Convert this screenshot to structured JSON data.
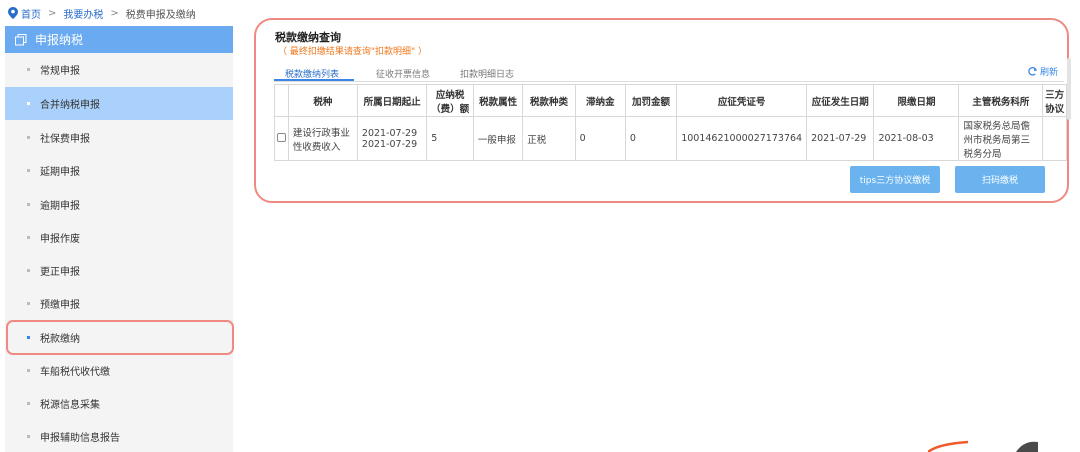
{
  "breadcrumb": {
    "home": "首页",
    "sep1": ">",
    "tax": "我要办税",
    "sep2": ">",
    "current": "税费申报及缴纳"
  },
  "sidebar": {
    "header": "申报纳税",
    "items": [
      {
        "label": "常规申报"
      },
      {
        "label": "合并纳税申报"
      },
      {
        "label": "社保费申报"
      },
      {
        "label": "延期申报"
      },
      {
        "label": "逾期申报"
      },
      {
        "label": "申报作废"
      },
      {
        "label": "更正申报"
      },
      {
        "label": "预缴申报"
      },
      {
        "label": "税款缴纳"
      },
      {
        "label": "车船税代收代缴"
      },
      {
        "label": "税源信息采集"
      },
      {
        "label": "申报辅助信息报告"
      }
    ]
  },
  "main": {
    "title": "税款缴纳查询",
    "notice": "（ 最终扣缴结果请查询\"扣款明细\" ）",
    "tabs": [
      {
        "label": "税款缴纳列表"
      },
      {
        "label": "征收开票信息"
      },
      {
        "label": "扣款明细日志"
      }
    ],
    "refresh": "刷新",
    "table": {
      "headers": [
        "税种",
        "所属日期起止",
        "应纳税（费）额",
        "税款属性",
        "税款种类",
        "滞纳金",
        "加罚金额",
        "应征凭证号",
        "应征发生日期",
        "限缴日期",
        "主管税务科所",
        "三方协议"
      ],
      "row": {
        "tax_type": "建设行政事业性收费收入",
        "date_start": "2021-07-29",
        "date_end": "2021-07-29",
        "amount": "5",
        "attribute": "一般申报",
        "category": "正税",
        "late_fee": "0",
        "penalty": "0",
        "voucher": "10014621000027173764",
        "occur_date": "2021-07-29",
        "deadline": "2021-08-03",
        "office": "国家税务总局儋州市税务局第三税务分局",
        "agreement": ""
      }
    },
    "buttons": {
      "tips": "tips三方协议缴税",
      "scan": "扫码缴税"
    }
  },
  "colors": {
    "accent": "#6aaaf1",
    "highlight": "#ef8a82",
    "notice": "#f0781e",
    "selected": "#a9d1fb"
  }
}
